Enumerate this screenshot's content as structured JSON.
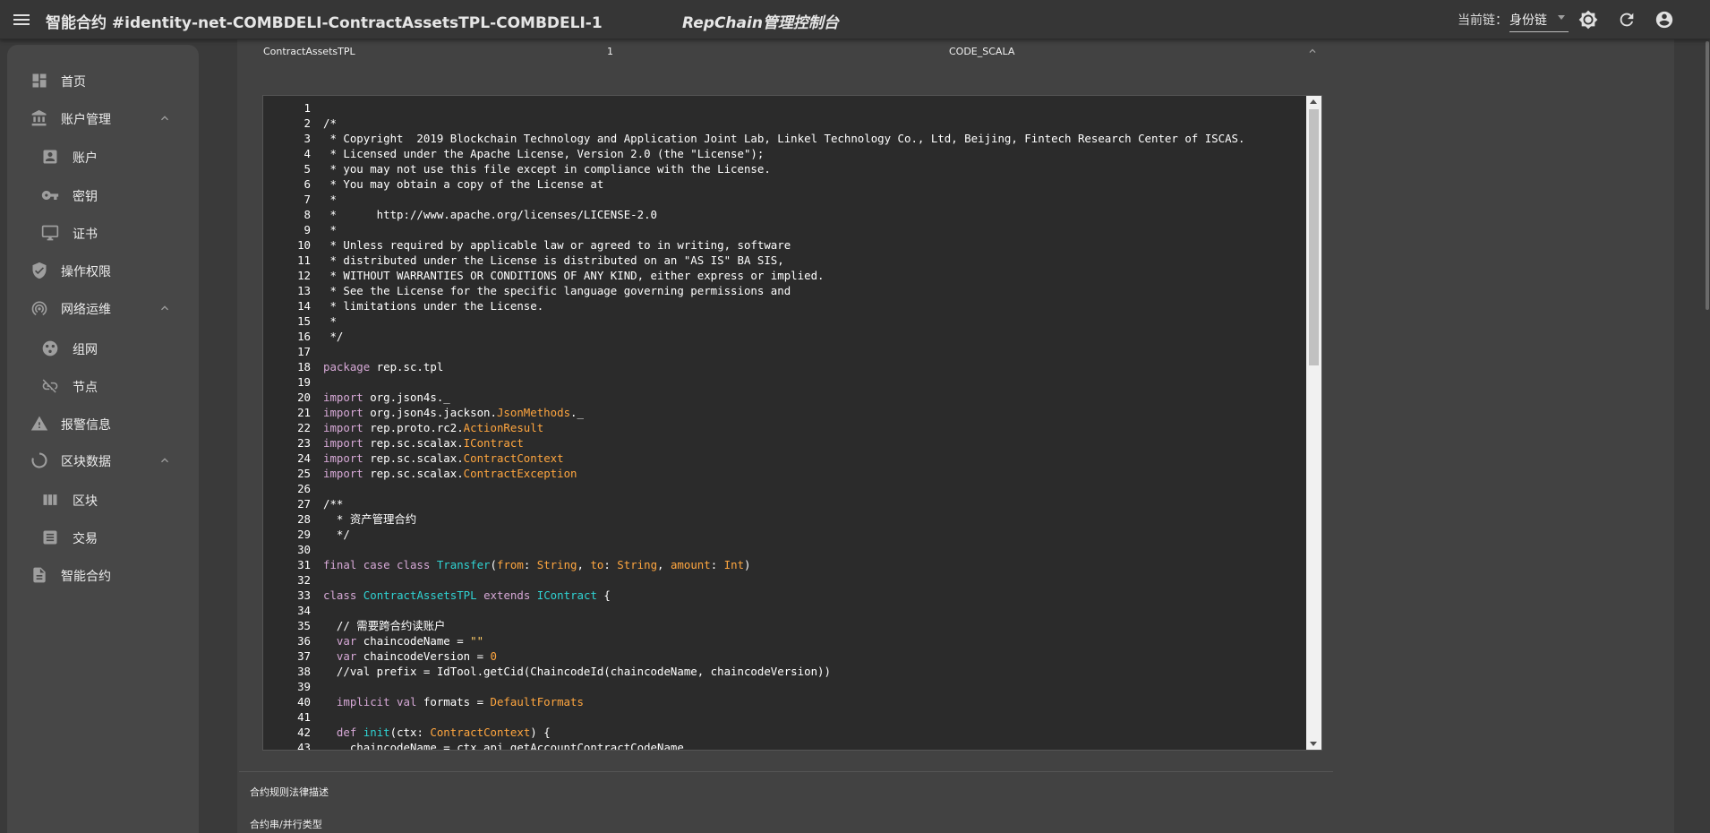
{
  "header": {
    "title": "智能合约 #identity-net-COMBDELI-ContractAssetsTPL-COMBDELI-1",
    "brand": "RepChain管理控制台",
    "chain_label": "当前链：",
    "chain_value": "身份链"
  },
  "sidebar": {
    "items": [
      {
        "label": "首页",
        "icon": "dashboard-icon"
      },
      {
        "label": "账户管理",
        "icon": "bank-icon",
        "expanded": true
      },
      {
        "label": "账户",
        "icon": "account-box-icon"
      },
      {
        "label": "密钥",
        "icon": "key-icon"
      },
      {
        "label": "证书",
        "icon": "monitor-icon"
      },
      {
        "label": "操作权限",
        "icon": "shield-icon"
      },
      {
        "label": "网络运维",
        "icon": "radar-icon",
        "expanded": true
      },
      {
        "label": "组网",
        "icon": "network-icon"
      },
      {
        "label": "节点",
        "icon": "link-off-icon"
      },
      {
        "label": "报警信息",
        "icon": "warning-icon"
      },
      {
        "label": "区块数据",
        "icon": "loading-icon",
        "expanded": true
      },
      {
        "label": "区块",
        "icon": "columns-icon"
      },
      {
        "label": "交易",
        "icon": "list-icon"
      },
      {
        "label": "智能合约",
        "icon": "document-icon"
      }
    ]
  },
  "contract": {
    "name": "ContractAssetsTPL",
    "version": "1",
    "code_type": "CODE_SCALA"
  },
  "code_lines": [
    [],
    [
      [
        "/*",
        "c"
      ]
    ],
    [
      [
        " * Copyright  2019 Blockchain Technology and Application Joint Lab, Linkel Technology Co., Ltd, Beijing, Fintech Research Center of ISCAS.",
        "c"
      ]
    ],
    [
      [
        " * Licensed under the Apache License, Version 2.0 (the \"License\");",
        "c"
      ]
    ],
    [
      [
        " * you may not use this file except in compliance with the License.",
        "c"
      ]
    ],
    [
      [
        " * You may obtain a copy of the License at",
        "c"
      ]
    ],
    [
      [
        " *",
        "c"
      ]
    ],
    [
      [
        " *      http://www.apache.org/licenses/LICENSE-2.0",
        "c"
      ]
    ],
    [
      [
        " *",
        "c"
      ]
    ],
    [
      [
        " * Unless required by applicable law or agreed to in writing, software",
        "c"
      ]
    ],
    [
      [
        " * distributed under the License is distributed on an \"AS IS\" BA SIS,",
        "c"
      ]
    ],
    [
      [
        " * WITHOUT WARRANTIES OR CONDITIONS OF ANY KIND, either express or implied.",
        "c"
      ]
    ],
    [
      [
        " * See the License for the specific language governing permissions and",
        "c"
      ]
    ],
    [
      [
        " * limitations under the License.",
        "c"
      ]
    ],
    [
      [
        " *",
        "c"
      ]
    ],
    [
      [
        " */",
        "c"
      ]
    ],
    [],
    [
      [
        "package",
        "k"
      ],
      [
        " rep.sc.tpl",
        "p"
      ]
    ],
    [],
    [
      [
        "import",
        "k"
      ],
      [
        " org.json4s._",
        "p"
      ]
    ],
    [
      [
        "import",
        "k"
      ],
      [
        " org.json4s.jackson.",
        "p"
      ],
      [
        "JsonMethods",
        "t"
      ],
      [
        "._",
        "p"
      ]
    ],
    [
      [
        "import",
        "k"
      ],
      [
        " rep.proto.rc2.",
        "p"
      ],
      [
        "ActionResult",
        "t"
      ]
    ],
    [
      [
        "import",
        "k"
      ],
      [
        " rep.sc.scalax.",
        "p"
      ],
      [
        "IContract",
        "t"
      ]
    ],
    [
      [
        "import",
        "k"
      ],
      [
        " rep.sc.scalax.",
        "p"
      ],
      [
        "ContractContext",
        "t"
      ]
    ],
    [
      [
        "import",
        "k"
      ],
      [
        " rep.sc.scalax.",
        "p"
      ],
      [
        "ContractException",
        "t"
      ]
    ],
    [],
    [
      [
        "/**",
        "c"
      ]
    ],
    [
      [
        "  * 资产管理合约",
        "c"
      ]
    ],
    [
      [
        "  */",
        "c"
      ]
    ],
    [],
    [
      [
        "final case class",
        "k"
      ],
      [
        " ",
        "p"
      ],
      [
        "Transfer",
        "s"
      ],
      [
        "(",
        "p"
      ],
      [
        "from",
        "t"
      ],
      [
        ": ",
        "p"
      ],
      [
        "String",
        "t"
      ],
      [
        ", ",
        "p"
      ],
      [
        "to",
        "t"
      ],
      [
        ": ",
        "p"
      ],
      [
        "String",
        "t"
      ],
      [
        ", ",
        "p"
      ],
      [
        "amount",
        "t"
      ],
      [
        ": ",
        "p"
      ],
      [
        "Int",
        "t"
      ],
      [
        ")",
        "p"
      ]
    ],
    [],
    [
      [
        "class",
        "k"
      ],
      [
        " ",
        "p"
      ],
      [
        "ContractAssetsTPL",
        "s"
      ],
      [
        " ",
        "p"
      ],
      [
        "extends",
        "k"
      ],
      [
        " ",
        "p"
      ],
      [
        "IContract",
        "s"
      ],
      [
        " {",
        "p"
      ]
    ],
    [],
    [
      [
        "  // 需要跨合约读账户",
        "c"
      ]
    ],
    [
      [
        "  var",
        "k"
      ],
      [
        " chaincodeName = ",
        "p"
      ],
      [
        "\"\"",
        "q"
      ]
    ],
    [
      [
        "  var",
        "k"
      ],
      [
        " chaincodeVersion = ",
        "p"
      ],
      [
        "0",
        "n"
      ]
    ],
    [
      [
        "  //val prefix = IdTool.getCid(ChaincodeId(chaincodeName, chaincodeVersion))",
        "c"
      ]
    ],
    [],
    [
      [
        "  implicit val",
        "k"
      ],
      [
        " formats = ",
        "p"
      ],
      [
        "DefaultFormats",
        "t"
      ]
    ],
    [],
    [
      [
        "  def",
        "k"
      ],
      [
        " ",
        "p"
      ],
      [
        "init",
        "s"
      ],
      [
        "(ctx: ",
        "p"
      ],
      [
        "ContractContext",
        "t"
      ],
      [
        ") {",
        "p"
      ]
    ],
    [
      [
        "    chaincodeName = ctx.api.getAccountContractCodeName",
        "p"
      ]
    ]
  ],
  "fields": {
    "legal_desc_label": "合约规则法律描述",
    "serial_type_label": "合约串/并行类型"
  },
  "colors": {
    "keyword": "#d6a8d6",
    "type": "#ffa63f",
    "class_name": "#2fd3d3",
    "code_bg": "#2b2b2b"
  }
}
